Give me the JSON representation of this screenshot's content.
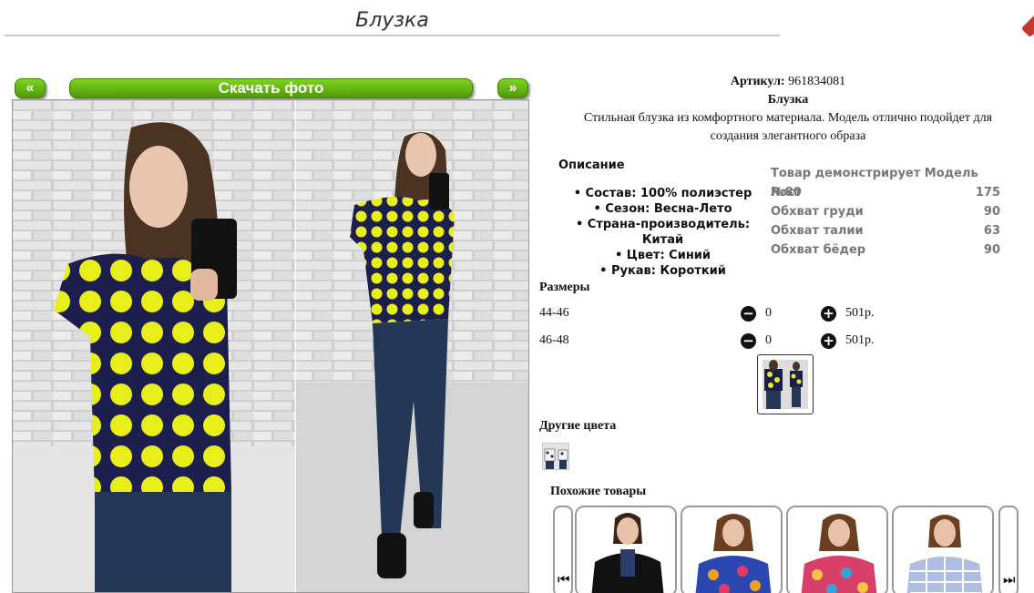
{
  "page": {
    "title": "Блузка"
  },
  "gallery": {
    "prev_label": "«",
    "next_label": "»",
    "download_label": "Скачать фото"
  },
  "product": {
    "article_label": "Артикул:",
    "article_value": "961834081",
    "name": "Блузка",
    "description_line1": "Стильная блузка из комфортного материала. Модель отлично подойдет для",
    "description_line2": "создания элегантного образа"
  },
  "description": {
    "title": "Описание",
    "items": [
      "• Состав: 100% полиэстер",
      "• Сезон: Весна-Лето",
      "• Страна-производитель: Китай",
      "• Цвет: Синий",
      "• Рукав: Короткий"
    ]
  },
  "model": {
    "header": "Товар демонстрирует Модель №80",
    "rows": [
      {
        "label": "Рост",
        "value": "175"
      },
      {
        "label": "Обхват груди",
        "value": "90"
      },
      {
        "label": "Обхват талии",
        "value": "63"
      },
      {
        "label": "Обхват бёдер",
        "value": "90"
      }
    ]
  },
  "sizes": {
    "title": "Размеры",
    "rows": [
      {
        "size": "44-46",
        "qty": "0",
        "price": "501р."
      },
      {
        "size": "46-48",
        "qty": "0",
        "price": "501р."
      }
    ],
    "minus_icon": "minus-circle-icon",
    "plus_icon": "plus-circle-icon"
  },
  "other_colors": {
    "title": "Другие цвета"
  },
  "similar": {
    "title": "Похожие товары",
    "prev_icon": "skip-back-icon",
    "next_icon": "skip-forward-icon"
  },
  "colors": {
    "accent_green": "#6fbf1c",
    "blouse_navy": "#1c1f4e",
    "polka_yellow": "#e8ee1a"
  }
}
